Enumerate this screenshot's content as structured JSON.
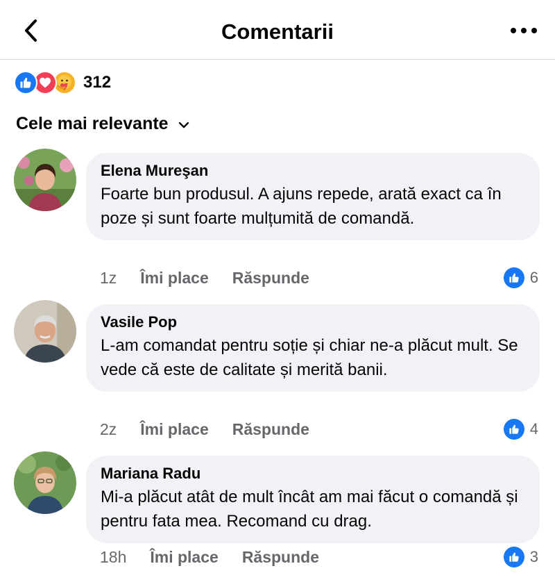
{
  "header": {
    "title": "Comentarii",
    "back_icon": "chevron-left-icon",
    "more_icon": "more-horizontal-icon"
  },
  "reactions": {
    "types": [
      "like-icon",
      "love-icon",
      "care-icon"
    ],
    "count": "312"
  },
  "sort": {
    "label": "Cele mai relevante",
    "icon": "chevron-down-icon"
  },
  "comments": [
    {
      "author": "Elena Mureşan",
      "text": "Foarte bun produsul. A ajuns repede, arată exact ca în poze și sunt foarte mulțumită de comandă.",
      "time": "1z",
      "like_label": "Îmi place",
      "reply_label": "Răspunde",
      "likes": "6"
    },
    {
      "author": "Vasile Pop",
      "text": "L-am comandat pentru soție și chiar ne-a plăcut mult. Se vede că este de calitate și merită banii.",
      "time": "2z",
      "like_label": "Îmi place",
      "reply_label": "Răspunde",
      "likes": "4"
    },
    {
      "author": "Mariana Radu",
      "text": "Mi-a plăcut atât de mult încât am mai făcut o comandă și pentru fata mea. Recomand cu drag.",
      "time": "18h",
      "like_label": "Îmi place",
      "reply_label": "Răspunde",
      "likes": "3"
    }
  ],
  "colors": {
    "accent": "#1877f2",
    "love": "#f33e58",
    "care": "#f7b125",
    "bubble": "#f0f2f5",
    "secondary_text": "#65676b"
  }
}
